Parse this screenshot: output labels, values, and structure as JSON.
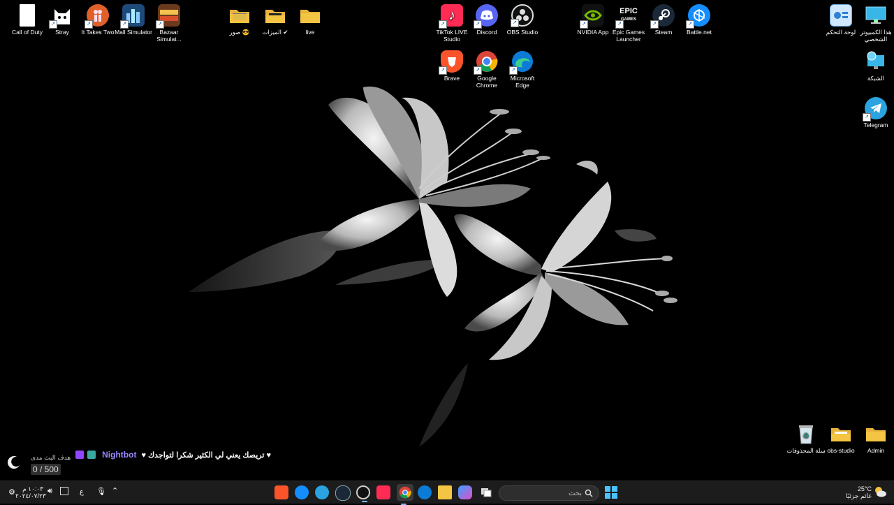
{
  "desktop": {
    "icons_left": [
      {
        "label": "Call of Duty",
        "icon": "document-icon"
      },
      {
        "label": "Stray",
        "icon": "cat-icon"
      },
      {
        "label": "It Takes Two",
        "icon": "it-takes-two-icon"
      },
      {
        "label": "Mall Simulator",
        "icon": "mall-simulator-icon"
      },
      {
        "label": "Bazaar Simulat...",
        "icon": "bazaar-icon"
      }
    ],
    "folders_top": [
      {
        "label": "صور 😎",
        "icon": "folder-icon"
      },
      {
        "label": "الميزات ✔",
        "icon": "folder-icon"
      },
      {
        "label": "live",
        "icon": "folder-icon"
      }
    ],
    "apps_row1": [
      {
        "label": "TikTok LIVE Studio",
        "icon": "tiktok-icon"
      },
      {
        "label": "Discord",
        "icon": "discord-icon"
      },
      {
        "label": "OBS Studio",
        "icon": "obs-icon"
      }
    ],
    "apps_row2": [
      {
        "label": "Brave",
        "icon": "brave-icon"
      },
      {
        "label": "Google Chrome",
        "icon": "chrome-icon"
      },
      {
        "label": "Microsoft Edge",
        "icon": "edge-icon"
      }
    ],
    "apps_launchers": [
      {
        "label": "NVIDIA App",
        "icon": "nvidia-icon"
      },
      {
        "label": "Epic Games Launcher",
        "icon": "epic-icon"
      },
      {
        "label": "Steam",
        "icon": "steam-icon"
      },
      {
        "label": "Battle.net",
        "icon": "battlenet-icon"
      }
    ],
    "icons_right": [
      {
        "label": "لوحة التحكم",
        "icon": "control-panel-icon"
      },
      {
        "label": "هذا الكمبيوتر الشخصي",
        "icon": "monitor-icon"
      },
      {
        "label": "الشبكة",
        "icon": "network-icon"
      },
      {
        "label": "Telegram",
        "icon": "telegram-icon"
      }
    ],
    "icons_bottom_right": [
      {
        "label": "سلة المحذوفات",
        "icon": "recycle-bin-icon"
      },
      {
        "label": "obs-studio",
        "icon": "folder-icon"
      },
      {
        "label": "Admin",
        "icon": "folder-icon"
      }
    ]
  },
  "chat_overlay": {
    "username": "Nightbot",
    "message": "♥ تريصك يعني لي الكثير شكرا لتواجدك ♥",
    "goal_label": "هدف البث مدى",
    "goal_count": "0 / 500"
  },
  "taskbar": {
    "search_placeholder": "بحث",
    "apps": [
      "brave-icon",
      "battlenet-icon",
      "telegram-icon",
      "steam-icon",
      "obs-icon",
      "tiktok-icon",
      "chrome-icon",
      "edge-icon",
      "file-explorer-icon",
      "copilot-icon",
      "task-view-icon"
    ],
    "weather_temp": "25°C",
    "weather_desc": "غائم جزئيًا",
    "time": "١٠:٠٣ م",
    "date": "٢٠٢٤/٠٧/٢٣",
    "lang": "ع"
  },
  "colors": {
    "chat_username": "#9b8cff",
    "taskbar_bg": "#1c1c1c",
    "folder": "#f4c542"
  }
}
